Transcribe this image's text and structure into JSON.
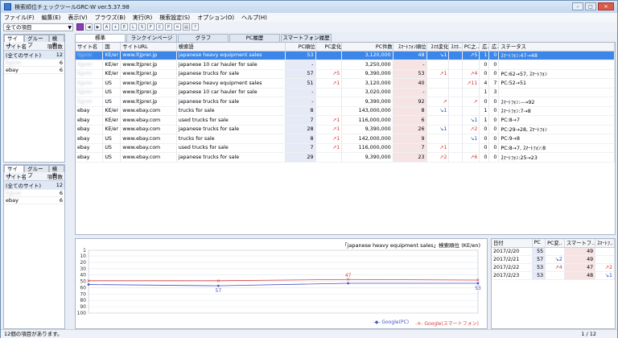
{
  "window": {
    "title": "検索順位チェックツールGRC-W  ver.5.37.98"
  },
  "menu": [
    "ファイル(F)",
    "編集(E)",
    "表示(V)",
    "ブラウズ(B)",
    "実行(R)",
    "検索設定(S)",
    "オプション(O)",
    "ヘルプ(H)"
  ],
  "site_select": {
    "value": "全ての項目"
  },
  "left_panel_top": {
    "tabs": [
      "サイト",
      "グループ",
      "検索"
    ],
    "headers": [
      "サイト名",
      "項目数"
    ],
    "rows": [
      [
        "(全てのサイト)",
        "12"
      ],
      [
        "ltjprer",
        "6"
      ],
      [
        "ebay",
        "6"
      ]
    ]
  },
  "left_panel_bottom": {
    "tabs": [
      "サイト",
      "グループ",
      "検索"
    ],
    "headers": [
      "サイト名",
      "項目数"
    ],
    "rows": [
      [
        "(全てのサイト)",
        "12"
      ],
      [
        "ltjprer",
        "6"
      ],
      [
        "ebay",
        "6"
      ]
    ]
  },
  "main_tabs": [
    "標準",
    "ランクインページ",
    "グラフ",
    "PC履歴",
    "スマートフォン履歴"
  ],
  "grid": {
    "headers": [
      "サイト名",
      "国",
      "サイトURL",
      "検索語",
      "PC順位",
      "PC変化",
      "PC件数",
      "ｽﾏｰﾄﾌｫﾝ順位",
      "ｽﾏﾎ変化",
      "ｽﾏﾎ..",
      "PC之..",
      "広.",
      "広.",
      "ステータス"
    ],
    "rows": [
      [
        "ltjprer",
        "KE/er",
        "www.ltjprer.jp",
        "japanese heavy equipment sales",
        "53",
        "",
        "3,120,000",
        "48",
        "↘1",
        "",
        "↗5",
        "1",
        "0",
        "ｽﾏｰﾄﾌｫﾝ:47→48"
      ],
      [
        "ltjprer",
        "KE/er",
        "www.ltjprer.jp",
        "japanese 10 car hauler for sale",
        "-",
        "",
        "3,250,000",
        "-",
        "",
        "",
        "",
        "0",
        "0",
        ""
      ],
      [
        "ltjprer",
        "KE/er",
        "www.ltjprer.jp",
        "japanese trucks for sale",
        "57",
        "↗5",
        "9,390,000",
        "53",
        "↗1",
        "",
        "↗4",
        "0",
        "0",
        "PC:62→57, ｽﾏｰﾄﾌｫﾝ"
      ],
      [
        "ltjprer",
        "US",
        "www.ltjprer.jp",
        "japanese heavy equipment sales",
        "51",
        "↗1",
        "3,120,000",
        "40",
        "",
        "",
        "↗11",
        "4",
        "7",
        "PC:52→51"
      ],
      [
        "ltjprer",
        "US",
        "www.ltjprer.jp",
        "japanese 10 car hauler for sale",
        "-",
        "",
        "3,020,000",
        "-",
        "",
        "",
        "",
        "1",
        "3",
        ""
      ],
      [
        "ltjprer",
        "US",
        "www.ltjprer.jp",
        "japanese trucks for sale",
        "-",
        "",
        "9,390,000",
        "92",
        "↗",
        "",
        "↗",
        "0",
        "0",
        "ｽﾏｰﾄﾌｫﾝ:--→92"
      ],
      [
        "ebay",
        "KE/er",
        "www.ebay.com",
        "trucks for sale",
        "8",
        "",
        "143,000,000",
        "8",
        "↘1",
        "",
        "",
        "1",
        "0",
        "ｽﾏｰﾄﾌｫﾝ:7→8"
      ],
      [
        "ebay",
        "KE/er",
        "www.ebay.com",
        "used trucks for sale",
        "7",
        "↗1",
        "116,000,000",
        "6",
        "",
        "",
        "↘1",
        "1",
        "0",
        "PC:8→7"
      ],
      [
        "ebay",
        "KE/er",
        "www.ebay.com",
        "japanese trucks for sale",
        "28",
        "↗1",
        "9,390,000",
        "26",
        "↘1",
        "",
        "↗2",
        "0",
        "0",
        "PC:29→28, ｽﾏｰﾄﾌｫﾝ"
      ],
      [
        "ebay",
        "US",
        "www.ebay.com",
        "trucks for sale",
        "8",
        "↗1",
        "142,000,000",
        "9",
        "",
        "",
        "↘1",
        "0",
        "0",
        "PC:9→8"
      ],
      [
        "ebay",
        "US",
        "www.ebay.com",
        "used trucks for sale",
        "7",
        "↗1",
        "116,000,000",
        "7",
        "↗1",
        "",
        "",
        "0",
        "0",
        "PC:8→7, ｽﾏｰﾄﾌｫﾝ:8"
      ],
      [
        "ebay",
        "US",
        "www.ebay.com",
        "japanese trucks for sale",
        "29",
        "",
        "9,390,000",
        "23",
        "↗2",
        "",
        "↗6",
        "0",
        "0",
        "ｽﾏｰﾄﾌｫﾝ:25→23"
      ]
    ]
  },
  "chart_data": {
    "type": "line",
    "title": "「japanese heavy equipment sales」検索順位 (KE/en)",
    "x": [
      "2017/2/20",
      "2017/2/21",
      "2017/2/22",
      "2017/2/23"
    ],
    "ylim": [
      100,
      1
    ],
    "yticks": [
      1,
      10,
      20,
      30,
      40,
      50,
      60,
      70,
      80,
      90,
      100
    ],
    "series": [
      {
        "name": "Google(PC)",
        "color": "#4453c8",
        "values": [
          55,
          57,
          53,
          53
        ]
      },
      {
        "name": "Google(スマートフォン)",
        "color": "#d84040",
        "values": [
          49,
          49,
          47,
          48
        ]
      }
    ],
    "labels": [
      {
        "series": 0,
        "index": 1,
        "text": "57"
      },
      {
        "series": 1,
        "index": 2,
        "text": "47"
      },
      {
        "series": 0,
        "index": 3,
        "text": "53"
      }
    ]
  },
  "history": {
    "headers": [
      "日付",
      "PC",
      "PC変..",
      "スマートフ..",
      "ｽﾏｰﾄﾌ.."
    ],
    "rows": [
      [
        "2017/2/20",
        "55",
        "",
        "49",
        ""
      ],
      [
        "2017/2/21",
        "57",
        "↘2",
        "49",
        ""
      ],
      [
        "2017/2/22",
        "53",
        "↗4",
        "47",
        "↗2"
      ],
      [
        "2017/2/23",
        "53",
        "",
        "48",
        "↘1"
      ]
    ]
  },
  "status": {
    "text": "12個の項目があります。",
    "page": "1 / 12"
  }
}
